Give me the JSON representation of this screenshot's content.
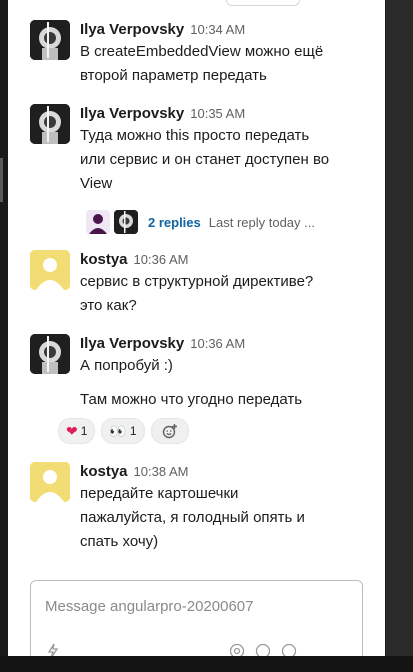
{
  "messages": [
    {
      "author": "Ilya Verpovsky",
      "time": "10:34 AM",
      "lines": [
        "В createEmbeddedView можно ещё",
        "второй параметр передать"
      ]
    },
    {
      "author": "Ilya Verpovsky",
      "time": "10:35 AM",
      "lines": [
        "Туда можно this просто передать",
        "или сервис и он станет доступен во",
        "View"
      ],
      "thread": {
        "replies_label": "2 replies",
        "last_reply": "Last reply today ..."
      }
    },
    {
      "author": "kostya",
      "time": "10:36 AM",
      "lines": [
        "сервис в структурной директиве?",
        "это как?"
      ]
    },
    {
      "author": "Ilya Verpovsky",
      "time": "10:36 AM",
      "lines": [
        "А попробуй :)"
      ],
      "followup": "Там можно что угодно передать",
      "reactions": [
        {
          "emoji": "❤",
          "icon": "heart-icon",
          "count": "1"
        },
        {
          "emoji": "👀",
          "icon": "eyes-icon",
          "count": "1"
        }
      ]
    },
    {
      "author": "kostya",
      "time": "10:38 AM",
      "lines": [
        "передайте картошечки",
        "пажалуйста, я голодный опять и",
        "спать хочу)"
      ]
    }
  ],
  "composer": {
    "placeholder": "Message angularpro-20200607"
  },
  "colors": {
    "link": "#1264a3",
    "heart": "#e01e5a",
    "kostya_avatar": "#f2dc74",
    "ilya_avatar": "#1f1f1f"
  }
}
